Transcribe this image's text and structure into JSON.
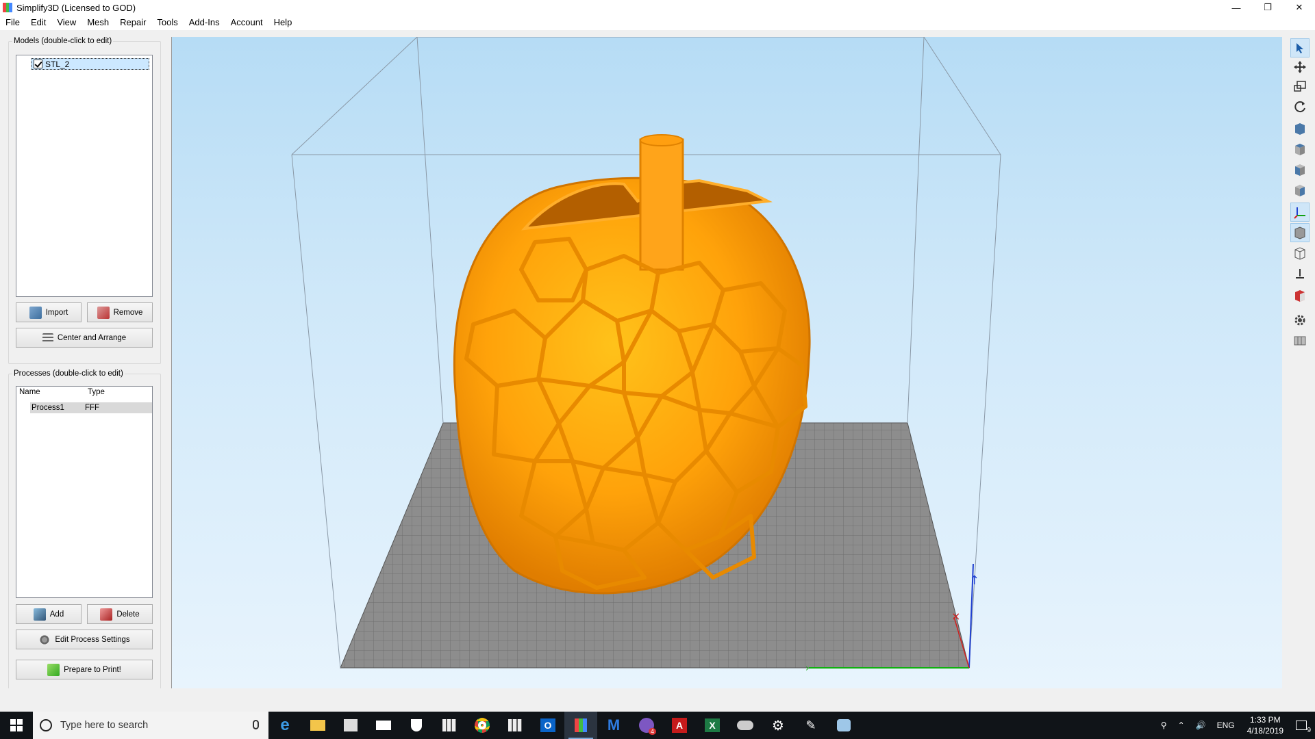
{
  "window": {
    "title": "Simplify3D (Licensed to GOD)",
    "controls": [
      "minimize",
      "restore",
      "close"
    ]
  },
  "menu": [
    "File",
    "Edit",
    "View",
    "Mesh",
    "Repair",
    "Tools",
    "Add-Ins",
    "Account",
    "Help"
  ],
  "models": {
    "group_title": "Models (double-click to edit)",
    "items": [
      {
        "name": "STL_2",
        "checked": true
      }
    ],
    "import_label": "Import",
    "remove_label": "Remove",
    "center_label": "Center and Arrange"
  },
  "processes": {
    "group_title": "Processes (double-click to edit)",
    "columns": [
      "Name",
      "Type"
    ],
    "rows": [
      {
        "name": "Process1",
        "type": "FFF"
      }
    ],
    "add_label": "Add",
    "delete_label": "Delete",
    "edit_label": "Edit Process Settings",
    "prepare_label": "Prepare to Print!"
  },
  "toolbar_icons": [
    "select-icon",
    "move-icon",
    "scale-icon",
    "rotate-icon",
    "view-front-icon",
    "view-top-icon",
    "view-left-icon",
    "view-right-icon",
    "axes-icon",
    "solid-view-icon",
    "wireframe-view-icon",
    "cross-section-icon",
    "model-color-icon",
    "settings-icon",
    "build-plate-icon"
  ],
  "taskbar": {
    "search_placeholder": "Type here to search",
    "apps": [
      "edge-icon",
      "file-explorer-icon",
      "store-icon",
      "mail-icon",
      "security-icon",
      "app-grid-icon",
      "chrome-icon",
      "app-grid-2-icon",
      "outlook-icon",
      "simplify3d-icon",
      "malwarebytes-icon",
      "viber-icon",
      "acrobat-icon",
      "excel-icon",
      "cloud-icon",
      "settings-icon",
      "notification-badge-icon",
      "paint-icon"
    ],
    "viber_badge": "4",
    "tray_lang": "ENG",
    "time": "1:33 PM",
    "date": "4/18/2019",
    "notification_count": "9"
  },
  "colors": {
    "model_orange": "#ffa000",
    "sky_top": "#b6dcf5",
    "bed_grey": "#8a8a8a",
    "taskbar": "#101418"
  }
}
